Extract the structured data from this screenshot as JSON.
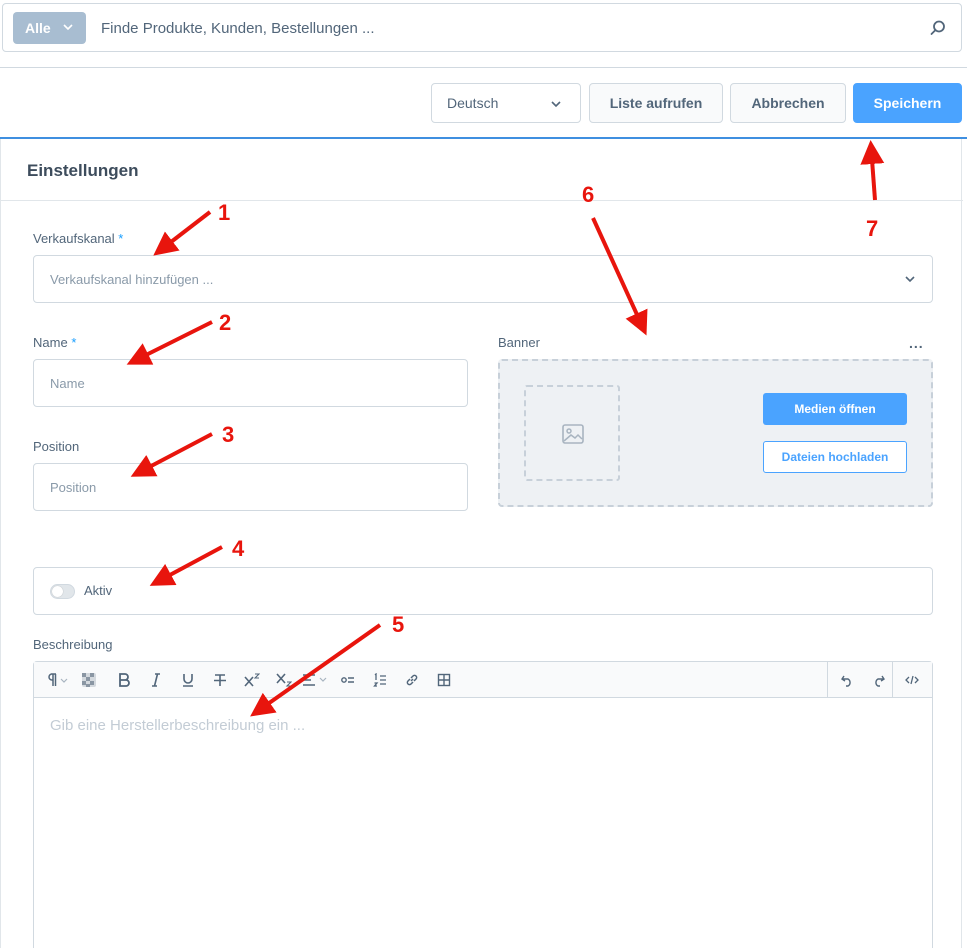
{
  "search": {
    "type_label": "Alle",
    "placeholder": "Finde Produkte, Kunden, Bestellungen ..."
  },
  "toolbar": {
    "language": "Deutsch",
    "list_label": "Liste aufrufen",
    "cancel_label": "Abbrechen",
    "save_label": "Speichern"
  },
  "card": {
    "title": "Einstellungen"
  },
  "form": {
    "sales_channel": {
      "label": "Verkaufskanal",
      "required": "*",
      "placeholder": "Verkaufskanal hinzufügen ..."
    },
    "name": {
      "label": "Name",
      "required": "*",
      "placeholder": "Name"
    },
    "position": {
      "label": "Position",
      "placeholder": "Position"
    },
    "banner": {
      "label": "Banner",
      "more": "...",
      "open_media": "Medien öffnen",
      "upload": "Dateien hochladen"
    },
    "active": {
      "label": "Aktiv"
    },
    "description": {
      "label": "Beschreibung",
      "placeholder": "Gib eine Herstellerbeschreibung ein ..."
    }
  },
  "annotations": [
    "1",
    "2",
    "3",
    "4",
    "5",
    "6",
    "7"
  ],
  "colors": {
    "accent": "#4aa3ff",
    "annotation": "#e8150d",
    "search_type_bg": "#a8bdd1"
  },
  "icons": [
    "chevron-down-icon",
    "search-icon",
    "image-icon",
    "paragraph-icon",
    "color-icon",
    "bold-icon",
    "italic-icon",
    "underline-icon",
    "strikethrough-icon",
    "superscript-icon",
    "subscript-icon",
    "align-icon",
    "bullet-list-icon",
    "numbered-list-icon",
    "link-icon",
    "table-icon",
    "undo-icon",
    "redo-icon",
    "code-view-icon"
  ]
}
